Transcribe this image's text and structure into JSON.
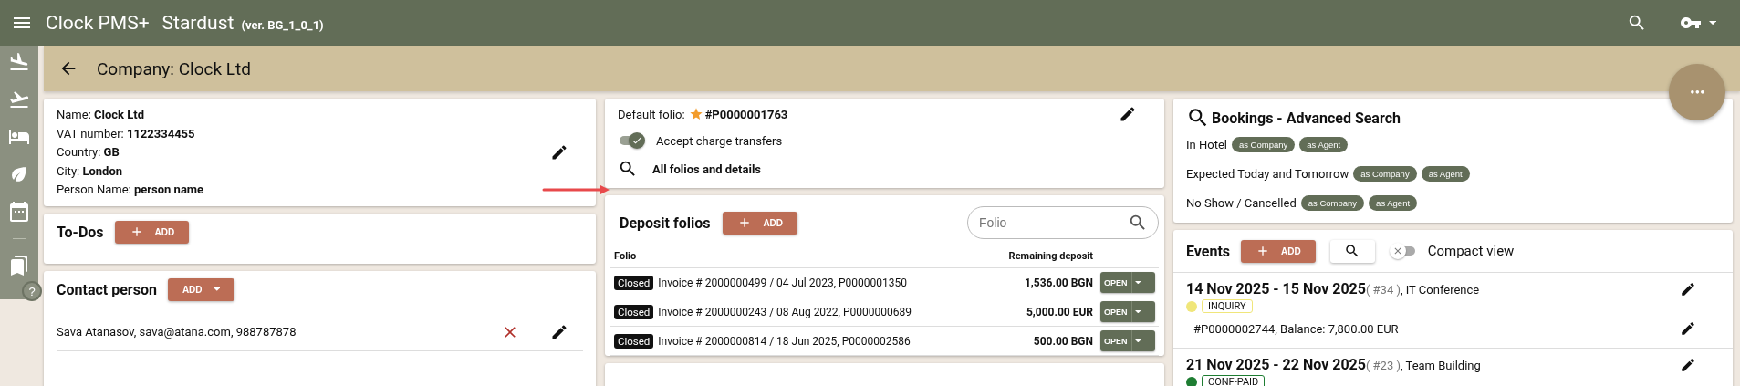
{
  "app_bar": {
    "title": "Clock PMS+",
    "hotel": "Stardust",
    "version": "(ver. BG_1_0_1)"
  },
  "help_label": "?",
  "page_title": "Company: Clock Ltd",
  "company": {
    "fields": [
      {
        "label": "Name:",
        "value": "Clock Ltd"
      },
      {
        "label": "VAT number:",
        "value": "1122334455"
      },
      {
        "label": "Country:",
        "value": "GB"
      },
      {
        "label": "City:",
        "value": "London"
      },
      {
        "label": "Person Name:",
        "value": "person name"
      }
    ]
  },
  "todos": {
    "title": "To-Dos",
    "add_label": "ADD"
  },
  "contact": {
    "title": "Contact person",
    "add_label": "ADD",
    "people": [
      "Sava Atanasov, sava@atana.com, 988787878"
    ]
  },
  "folio": {
    "default_label": "Default folio:",
    "default_value": "#P0000001763",
    "accept_transfers": {
      "label": "Accept charge transfers",
      "on": true
    },
    "all_link": "All folios and details"
  },
  "deposits": {
    "title": "Deposit folios",
    "add_label": "ADD",
    "search": {
      "placeholder": "Folio"
    },
    "columns": [
      "Folio",
      "Remaining deposit"
    ],
    "rows": [
      {
        "status": "Closed",
        "text": "Invoice  # 2000000499 / 04 Jul 2023, P0000001350",
        "amount": "1,536.00 BGN",
        "action": "OPEN"
      },
      {
        "status": "Closed",
        "text": "Invoice  # 2000000243 / 08 Aug 2022, P0000000689",
        "amount": "5,000.00 EUR",
        "action": "OPEN"
      },
      {
        "status": "Closed",
        "text": "Invoice  # 2000000814 / 18 Jun 2025, P0000002586",
        "amount": "500.00 BGN",
        "action": "OPEN"
      }
    ]
  },
  "bookings": {
    "title": "Bookings - Advanced Search",
    "groups": [
      {
        "label": "In Hotel",
        "chips": [
          "as Company",
          "as Agent"
        ]
      },
      {
        "label": "Expected Today and Tomorrow",
        "chips": [
          "as Company",
          "as Agent"
        ]
      },
      {
        "label": "No Show / Cancelled",
        "chips": [
          "as Company",
          "as Agent"
        ]
      }
    ]
  },
  "events": {
    "title": "Events",
    "add_label": "ADD",
    "compact": {
      "label": "Compact view",
      "on": false
    },
    "items": [
      {
        "dates": "14 Nov 2025 - 15 Nov 2025",
        "number": "( #34 )",
        "name": ", IT Conference",
        "status": "INQUIRY",
        "color": "#f0e67a",
        "folios": [
          "#P0000002744, Balance: 7,800.00 EUR"
        ]
      },
      {
        "dates": "21 Nov 2025 - 22 Nov 2025",
        "number": "( #23 )",
        "name": ", Team Building",
        "status": "CONF-PAID",
        "color": "#1e7d32"
      }
    ]
  }
}
